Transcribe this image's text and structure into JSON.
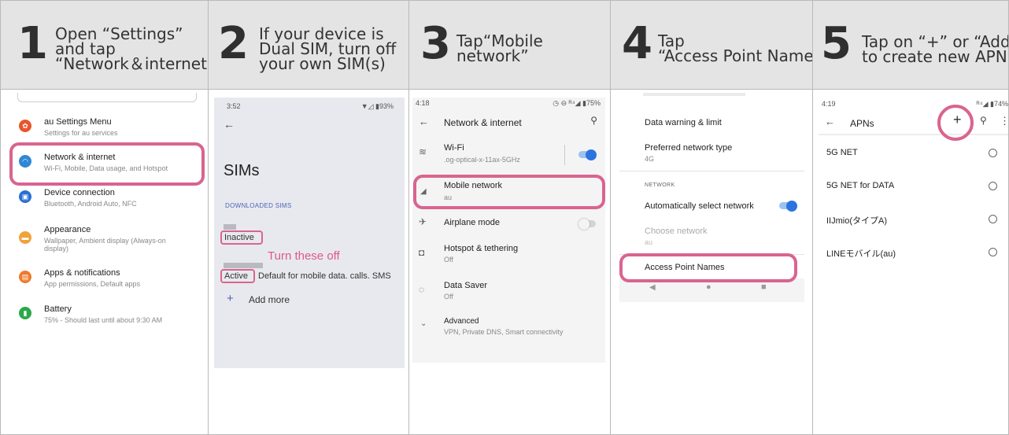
{
  "steps": [
    {
      "num": "1",
      "line1": "Open “Settings”",
      "line2": "and tap",
      "line3": "“Network＆internet”"
    },
    {
      "num": "2",
      "line1": "If your device is",
      "line2": "Dual SIM, turn off",
      "line3": "your own SIM(s)"
    },
    {
      "num": "3",
      "line1": "Tap“Mobile",
      "line2": "network”"
    },
    {
      "num": "4",
      "line1": "Tap",
      "line2": "“Access Point Names”"
    },
    {
      "num": "5",
      "line1": "Tap on “+” or “Add”",
      "line2": "to create new APN."
    }
  ],
  "screen1": {
    "items": [
      {
        "title": "au Settings Menu",
        "sub": "Settings for au services",
        "icon": "gear-icon",
        "color": "#e8552c"
      },
      {
        "title": "Network & internet",
        "sub": "Wi-Fi, Mobile, Data usage, and Hotspot",
        "icon": "wifi-icon",
        "color": "#2f88d6"
      },
      {
        "title": "Device connection",
        "sub": "Bluetooth, Android Auto, NFC",
        "icon": "devices-icon",
        "color": "#2b6fd1"
      },
      {
        "title": "Appearance",
        "sub": "Wallpaper, Ambient display (Always-on",
        "sub2": "display)",
        "icon": "palette-icon",
        "color": "#f2a23b"
      },
      {
        "title": "Apps & notifications",
        "sub": "App permissions, Default apps",
        "icon": "apps-icon",
        "color": "#f07a2c"
      },
      {
        "title": "Battery",
        "sub": "75% - Should last until about 9:30 AM",
        "icon": "battery-icon",
        "color": "#2ba84a"
      }
    ]
  },
  "screen2": {
    "time": "3:52",
    "status": "▼◿ ▮93%",
    "title": "SIMs",
    "section": "DOWNLOADED SIMS",
    "inactive": "Inactive",
    "active": "Active",
    "active_desc": "Default for mobile data. calls. SMS",
    "annotation": "Turn these off",
    "add_more": "Add more"
  },
  "screen3": {
    "time": "4:18",
    "status": "◷ ⊖ ᴿ⁴◢ ▮75%",
    "title": "Network & internet",
    "items": [
      {
        "title": "Wi-Fi",
        "sub": ".og-optical-x-11ax-5GHz",
        "icon": "wifi-icon"
      },
      {
        "title": "Mobile network",
        "sub": "au",
        "icon": "signal-icon"
      },
      {
        "title": "Airplane mode",
        "sub": "",
        "icon": "airplane-icon"
      },
      {
        "title": "Hotspot & tethering",
        "sub": "Off",
        "icon": "hotspot-icon"
      },
      {
        "title": "Data Saver",
        "sub": "Off",
        "icon": "data-saver-icon"
      },
      {
        "title": "Advanced",
        "sub": "VPN, Private DNS, Smart connectivity",
        "icon": "chevron-down-icon"
      }
    ]
  },
  "screen4": {
    "items": [
      {
        "title": "Data warning & limit",
        "sub": ""
      },
      {
        "title": "Preferred network type",
        "sub": "4G"
      }
    ],
    "section": "NETWORK",
    "auto_select": "Automatically select network",
    "choose": "Choose network",
    "choose_sub": "au",
    "apn": "Access Point Names"
  },
  "screen5": {
    "time": "4:19",
    "status": "ᴿ⁴◢ ▮74%",
    "title": "APNs",
    "apns": [
      "5G NET",
      "5G NET for DATA",
      "IIJmio(タイプA)",
      "LINEモバイル(au)"
    ]
  }
}
